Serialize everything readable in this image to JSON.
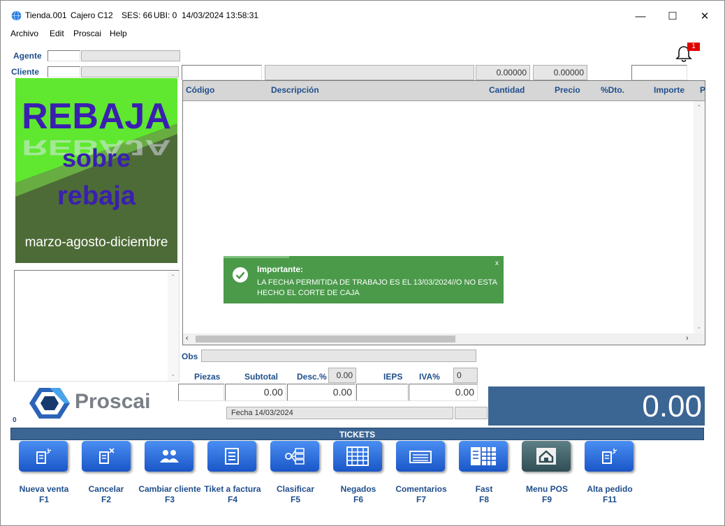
{
  "window": {
    "title_store": "Tienda.001",
    "title_cashier": "Cajero C12",
    "title_ses": "SES: 66",
    "title_ubi": "UBI: 0",
    "title_datetime": "14/03/2024 13:58:31",
    "minimize_glyph": "—",
    "maximize_glyph": "☐",
    "close_glyph": "✕"
  },
  "menu": {
    "archivo": "Archivo",
    "edit": "Edit",
    "proscai": "Proscai",
    "help": "Help"
  },
  "header": {
    "agente_label": "Agente",
    "cliente_label": "Cliente",
    "value_1": "0.00000",
    "value_2": "0.00000",
    "notification_count": "1"
  },
  "promo": {
    "line1": "REBAJA",
    "line2": "sobre",
    "line3": "rebaja",
    "months": "marzo-agosto-diciembre"
  },
  "grid": {
    "columns": [
      "Código",
      "Descripción",
      "Cantidad",
      "Precio",
      "%Dto.",
      "Importe",
      "P"
    ]
  },
  "toast": {
    "title": "Importante:",
    "line1": "LA FECHA PERMITIDA DE TRABAJO ES EL 13/03/2024//O NO ESTA",
    "line2": "HECHO EL CORTE DE CAJA",
    "close": "x"
  },
  "totals": {
    "obs_label": "Obs",
    "piezas_label": "Piezas",
    "subtotal_label": "Subtotal",
    "desc_label": "Desc.%",
    "desc_value": "0.00",
    "ieps_label": "IEPS",
    "iva_label": "IVA%",
    "iva_value": "0",
    "subtotal_value": "0.00",
    "desc_amount": "0.00",
    "iva_amount": "0.00",
    "fecha": "Fecha 14/03/2024",
    "grand_total": "0.00",
    "counter": "0"
  },
  "brand": {
    "name": "Proscai"
  },
  "tickets_label": "TICKETS",
  "buttons": [
    {
      "label": "Nueva venta",
      "key": "F1"
    },
    {
      "label": "Cancelar",
      "key": "F2"
    },
    {
      "label": "Cambiar cliente",
      "key": "F3"
    },
    {
      "label": "Tiket a factura",
      "key": "F4"
    },
    {
      "label": "Clasificar",
      "key": "F5"
    },
    {
      "label": "Negados",
      "key": "F6"
    },
    {
      "label": "Comentarios",
      "key": "F7"
    },
    {
      "label": "Fast",
      "key": "F8"
    },
    {
      "label": "Menu POS",
      "key": "F9"
    },
    {
      "label": "Alta pedido",
      "key": "F11"
    }
  ],
  "colors": {
    "accent_blue": "#3b6593",
    "label_blue": "#1f4e8c",
    "toast_green": "#4a9a4a",
    "promo_green": "#5fe82f",
    "promo_dark": "#4d6b37",
    "promo_text": "#3a1fb0"
  }
}
